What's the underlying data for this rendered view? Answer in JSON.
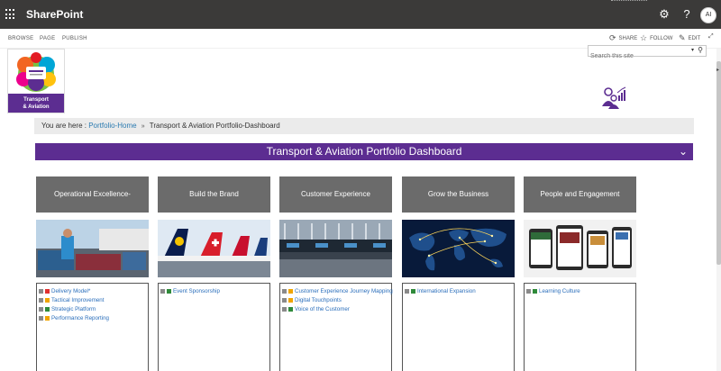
{
  "suitebar": {
    "app_name": "SharePoint",
    "icons": [
      "waffle-icon",
      "gear-icon",
      "help-icon"
    ],
    "help_glyph": "?",
    "settings_glyph": "⚙",
    "avatar_initials": "AI"
  },
  "ribbon": {
    "tabs": [
      "BROWSE",
      "PAGE",
      "PUBLISH"
    ],
    "share_label": "SHARE",
    "follow_label": "FOLLOW",
    "edit_label": "EDIT"
  },
  "search": {
    "placeholder": "Search this site"
  },
  "logo": {
    "line1": "Transport",
    "line2": "& Aviation"
  },
  "breadcrumb": {
    "prefix": "You are here :",
    "home": "Portfolio-Home",
    "separator": "»",
    "current": "Transport & Aviation Portfolio-Dashboard"
  },
  "banner": {
    "title": "Transport & Aviation Portfolio Dashboard",
    "chevron": "⌄"
  },
  "colors": {
    "purple": "#5c2d91",
    "tile_grey": "#6b6b6b",
    "status_red": "#e03131",
    "status_amber": "#f0a500",
    "status_green": "#2f8a3a",
    "bullet_grey": "#8a8a8a",
    "link_blue": "#2a6ebb"
  },
  "categories": [
    {
      "title": "Operational Excellence-",
      "items": [
        {
          "label": "Delivery Model*",
          "status": "red"
        },
        {
          "label": "Tactical Improvement",
          "status": "amber"
        },
        {
          "label": "Strategic Platform",
          "status": "green"
        },
        {
          "label": "Performance Reporting",
          "status": "amber"
        }
      ]
    },
    {
      "title": "Build the Brand",
      "items": [
        {
          "label": "Event Sponsorship",
          "status": "green"
        }
      ]
    },
    {
      "title": "Customer Experience",
      "items": [
        {
          "label": "Customer Experience Journey Mapping",
          "status": "amber"
        },
        {
          "label": "Digital Touchpoints",
          "status": "amber"
        },
        {
          "label": "Voice of the Customer",
          "status": "green"
        }
      ]
    },
    {
      "title": "Grow the Business",
      "items": [
        {
          "label": "International Expansion",
          "status": "green"
        }
      ]
    },
    {
      "title": "People and Engagement",
      "items": [
        {
          "label": "Learning Culture",
          "status": "green"
        }
      ]
    }
  ]
}
